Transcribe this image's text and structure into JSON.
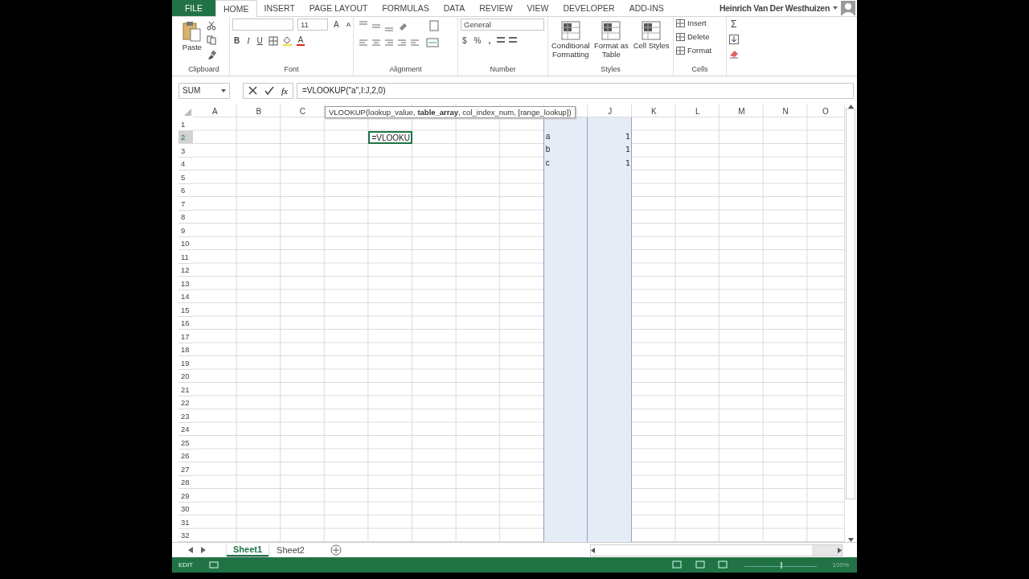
{
  "tabs": [
    {
      "label": "FILE",
      "kind": "file",
      "selected": false
    },
    {
      "label": "HOME",
      "kind": "tab",
      "selected": true
    },
    {
      "label": "INSERT",
      "kind": "tab",
      "selected": false
    },
    {
      "label": "PAGE LAYOUT",
      "kind": "tab",
      "selected": false
    },
    {
      "label": "FORMULAS",
      "kind": "tab",
      "selected": false
    },
    {
      "label": "DATA",
      "kind": "tab",
      "selected": false
    },
    {
      "label": "REVIEW",
      "kind": "tab",
      "selected": false
    },
    {
      "label": "VIEW",
      "kind": "tab",
      "selected": false
    },
    {
      "label": "DEVELOPER",
      "kind": "tab",
      "selected": false
    },
    {
      "label": "ADD-INS",
      "kind": "tab",
      "selected": false
    }
  ],
  "user": {
    "name": "Heinrich Van Der Westhuizen"
  },
  "ribbon": {
    "clipboard": {
      "label": "Clipboard",
      "paste": "Paste"
    },
    "font": {
      "label": "Font",
      "size": "11",
      "grow": "A",
      "shrink": "A",
      "bold": "B",
      "italic": "I",
      "underline": "U",
      "font_color": "A"
    },
    "alignment": {
      "label": "Alignment"
    },
    "number": {
      "label": "Number",
      "format": "General",
      "currency": "$",
      "percent": "%",
      "comma": ","
    },
    "styles": {
      "label": "Styles",
      "buttons": [
        "Conditional Formatting",
        "Format as Table",
        "Cell Styles"
      ]
    },
    "cells": {
      "label": "Cells",
      "buttons": [
        "Insert",
        "Delete",
        "Format"
      ]
    },
    "editing": {
      "sum": "Σ"
    }
  },
  "formula_bar": {
    "name_box": "SUM",
    "fx": "fx",
    "formula": "=VLOOKUP(\"a\",I:J,2,0)"
  },
  "tooltip": "VLOOKUP(lookup_value, **table_array**, col_index_num, [range_lookup])",
  "columns": [
    {
      "label": "A",
      "referenced": false
    },
    {
      "label": "B",
      "referenced": false
    },
    {
      "label": "C",
      "referenced": false
    },
    {
      "referenced": false
    },
    {
      "referenced": false
    },
    {
      "referenced": false
    },
    {
      "referenced": false
    },
    {
      "referenced": false
    },
    {
      "referenced": true
    },
    {
      "label": "J",
      "referenced": true
    },
    {
      "label": "K",
      "referenced": false
    },
    {
      "label": "L",
      "referenced": false
    },
    {
      "label": "M",
      "referenced": false
    },
    {
      "label": "N",
      "referenced": false
    },
    {
      "label": "O",
      "referenced": false
    }
  ],
  "rows": [
    {
      "label": "1",
      "selected": false
    },
    {
      "label": "2",
      "selected": true,
      "cells": {
        "E": {
          "text": "=VLOOKU",
          "active": true
        },
        "I": {
          "text": "a",
          "active": false
        },
        "J": {
          "text": "1",
          "kind": "number",
          "active": false
        }
      }
    },
    {
      "label": "3",
      "selected": false,
      "cells": {
        "I": {
          "text": "b",
          "active": false
        },
        "J": {
          "text": "1",
          "kind": "number",
          "active": false
        }
      }
    },
    {
      "label": "4",
      "selected": false,
      "cells": {
        "I": {
          "text": "c",
          "active": false
        },
        "J": {
          "text": "1",
          "kind": "number",
          "active": false
        }
      }
    },
    {
      "label": "5",
      "selected": false
    },
    {
      "label": "6",
      "selected": false
    },
    {
      "label": "7",
      "selected": false
    },
    {
      "label": "8",
      "selected": false
    },
    {
      "label": "9",
      "selected": false
    },
    {
      "label": "10",
      "selected": false
    },
    {
      "label": "11",
      "selected": false
    },
    {
      "label": "12",
      "selected": false
    },
    {
      "label": "13",
      "selected": false
    },
    {
      "label": "14",
      "selected": false
    },
    {
      "label": "15",
      "selected": false
    },
    {
      "label": "16",
      "selected": false
    },
    {
      "label": "17",
      "selected": false
    },
    {
      "label": "18",
      "selected": false
    },
    {
      "label": "19",
      "selected": false
    },
    {
      "label": "20",
      "selected": false
    },
    {
      "label": "21",
      "selected": false
    },
    {
      "label": "22",
      "selected": false
    },
    {
      "label": "23",
      "selected": false
    },
    {
      "label": "24",
      "selected": false
    },
    {
      "label": "25",
      "selected": false
    },
    {
      "label": "26",
      "selected": false
    },
    {
      "label": "27",
      "selected": false
    },
    {
      "label": "28",
      "selected": false
    },
    {
      "label": "29",
      "selected": false
    },
    {
      "label": "30",
      "selected": false
    },
    {
      "label": "31",
      "selected": false
    },
    {
      "label": "32",
      "selected": false
    }
  ],
  "sheets": [
    {
      "label": "Sheet1",
      "selected": true
    },
    {
      "label": "Sheet2",
      "selected": false
    }
  ],
  "status_bar": {
    "mode": "EDIT",
    "zoom": "100%",
    "zoom_slider": {
      "level": 0.5
    }
  }
}
